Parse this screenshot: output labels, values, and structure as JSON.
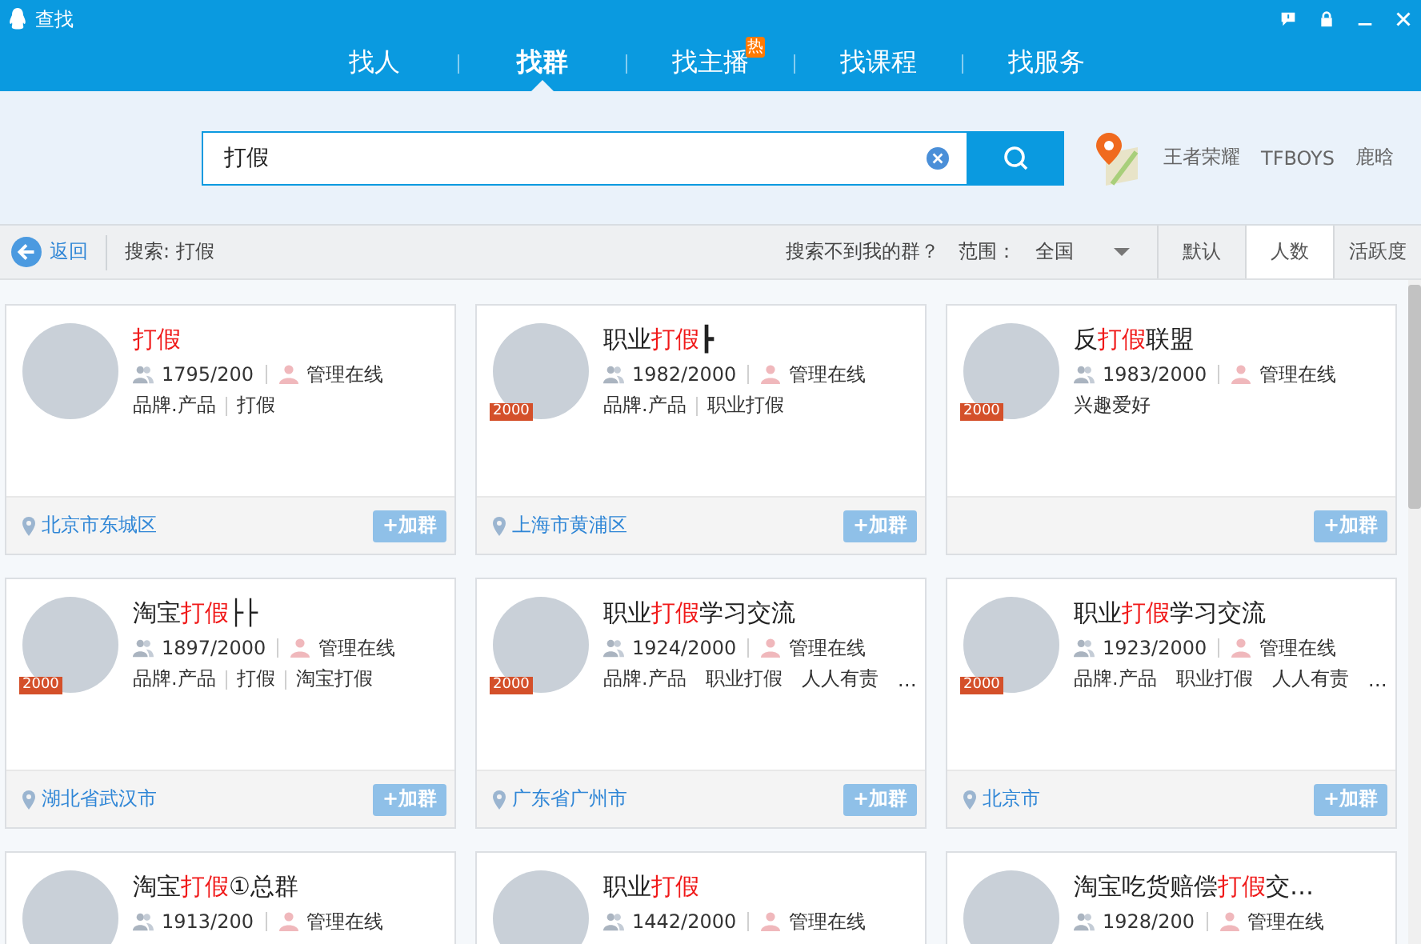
{
  "window": {
    "title": "查找"
  },
  "tabs": [
    {
      "label": "找人",
      "selected": false
    },
    {
      "label": "找群",
      "selected": true
    },
    {
      "label": "找主播",
      "selected": false,
      "badge": "热"
    },
    {
      "label": "找课程",
      "selected": false
    },
    {
      "label": "找服务",
      "selected": false
    }
  ],
  "search": {
    "value": "打假"
  },
  "hot_searches": [
    "王者荣耀",
    "TFBOYS",
    "鹿晗"
  ],
  "toolbar": {
    "back": "返回",
    "query": "搜索: 打假",
    "help": "搜索不到我的群？",
    "range_label": "范围：",
    "range_value": "全国",
    "sort_tabs": [
      {
        "label": "默认",
        "selected": false
      },
      {
        "label": "人数",
        "selected": true
      },
      {
        "label": "活跃度",
        "selected": false
      }
    ]
  },
  "groups": [
    {
      "name_parts": [
        {
          "text": "打假",
          "highlight": true
        }
      ],
      "members": "1795/200",
      "admin": "管理在线",
      "tags": [
        "品牌.产品",
        "打假"
      ],
      "location": "北京市东城区",
      "join": "+加群"
    },
    {
      "name_parts": [
        {
          "text": "职业",
          "highlight": false
        },
        {
          "text": "打假",
          "highlight": true
        },
        {
          "text": "┣",
          "highlight": false
        }
      ],
      "badge": "2000",
      "members": "1982/2000",
      "admin": "管理在线",
      "tags": [
        "品牌.产品",
        "职业打假"
      ],
      "location": "上海市黄浦区",
      "join": "+加群"
    },
    {
      "name_parts": [
        {
          "text": "反",
          "highlight": false
        },
        {
          "text": "打假",
          "highlight": true
        },
        {
          "text": "联盟",
          "highlight": false
        }
      ],
      "badge": "2000",
      "members": "1983/2000",
      "admin": "管理在线",
      "tags": [
        "兴趣爱好"
      ],
      "join": "+加群"
    },
    {
      "name_parts": [
        {
          "text": "淘宝",
          "highlight": false
        },
        {
          "text": "打假",
          "highlight": true
        },
        {
          "text": "├├",
          "highlight": false
        }
      ],
      "badge": "2000",
      "members": "1897/2000",
      "admin": "管理在线",
      "tags": [
        "品牌.产品",
        "打假",
        "淘宝打假"
      ],
      "location": "湖北省武汉市",
      "join": "+加群"
    },
    {
      "name_parts": [
        {
          "text": "职业",
          "highlight": false
        },
        {
          "text": "打假",
          "highlight": true
        },
        {
          "text": "学习交流",
          "highlight": false
        }
      ],
      "badge": "2000",
      "members": "1924/2000",
      "admin": "管理在线",
      "tags": [
        "品牌.产品",
        "职业打假",
        "人人有责",
        "…"
      ],
      "location": "广东省广州市",
      "join": "+加群"
    },
    {
      "name_parts": [
        {
          "text": "职业",
          "highlight": false
        },
        {
          "text": "打假",
          "highlight": true
        },
        {
          "text": "学习交流",
          "highlight": false
        }
      ],
      "badge": "2000",
      "members": "1923/2000",
      "admin": "管理在线",
      "tags": [
        "品牌.产品",
        "职业打假",
        "人人有责",
        "…"
      ],
      "location": "北京市",
      "join": "+加群"
    },
    {
      "name_parts": [
        {
          "text": "淘宝",
          "highlight": false
        },
        {
          "text": "打假",
          "highlight": true
        },
        {
          "text": "①总群",
          "highlight": false
        }
      ],
      "members": "1913/200",
      "admin": "管理在线"
    },
    {
      "name_parts": [
        {
          "text": "职业",
          "highlight": false
        },
        {
          "text": "打假",
          "highlight": true
        }
      ],
      "members": "1442/2000",
      "admin": "管理在线"
    },
    {
      "name_parts": [
        {
          "text": "淘宝吃货赔偿",
          "highlight": false
        },
        {
          "text": "打假",
          "highlight": true
        },
        {
          "text": "交…",
          "highlight": false
        }
      ],
      "members": "1928/200",
      "admin": "管理在线"
    }
  ]
}
